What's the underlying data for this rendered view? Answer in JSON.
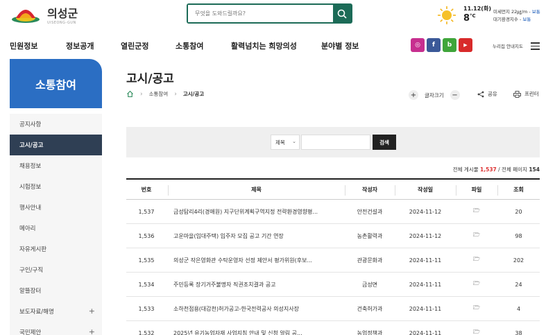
{
  "site": {
    "logo_name": "의성군",
    "logo_sub": "UISEONG-GUN"
  },
  "search": {
    "placeholder": "무엇을 도와드릴까요?"
  },
  "weather": {
    "date": "11.12(화)",
    "temp": "8",
    "temp_unit": "°C",
    "dust_label": "미세먼지 22㎍/m - ",
    "dust_status": "보통",
    "air_label": "대기환경지수 - ",
    "air_status": "보통"
  },
  "nav": {
    "items": [
      "민원정보",
      "정보공개",
      "열린군정",
      "소통참여",
      "활력넘치는 희망의성",
      "분야별 정보"
    ],
    "sns": [
      {
        "name": "instagram",
        "label": "◎",
        "color": "#c72f8f"
      },
      {
        "name": "facebook",
        "label": "f",
        "color": "#3b5998"
      },
      {
        "name": "blog",
        "label": "b",
        "color": "#3fa53a"
      },
      {
        "name": "youtube",
        "label": "▶",
        "color": "#d82a2a"
      }
    ],
    "sitemap": "누리집 안내지도"
  },
  "sidebar": {
    "title": "소통참여",
    "items": [
      {
        "label": "공지사항",
        "active": false,
        "plus": ""
      },
      {
        "label": "고시/공고",
        "active": true,
        "plus": ""
      },
      {
        "label": "채용정보",
        "active": false,
        "plus": ""
      },
      {
        "label": "시험정보",
        "active": false,
        "plus": ""
      },
      {
        "label": "행사안내",
        "active": false,
        "plus": ""
      },
      {
        "label": "메아리",
        "active": false,
        "plus": ""
      },
      {
        "label": "자유게시판",
        "active": false,
        "plus": ""
      },
      {
        "label": "구인/구직",
        "active": false,
        "plus": ""
      },
      {
        "label": "알뜰장터",
        "active": false,
        "plus": ""
      },
      {
        "label": "보도자료/해명",
        "active": false,
        "plus": "+"
      },
      {
        "label": "국민제안",
        "active": false,
        "plus": "+"
      }
    ]
  },
  "page": {
    "title": "고시/공고",
    "breadcrumb": [
      "소통참여",
      "고시/공고"
    ],
    "font_size_label": "글자크기",
    "share_label": "공유",
    "print_label": "프린터"
  },
  "filter": {
    "select_value": "제목",
    "button": "검색"
  },
  "summary": {
    "prefix": "전체 게시물 ",
    "total": "1,537",
    "middle": " / 전체 페이지 ",
    "pages": "154"
  },
  "table": {
    "headers": [
      "번호",
      "제목",
      "작성자",
      "작성일",
      "파일",
      "조회"
    ],
    "rows": [
      {
        "no": "1,537",
        "title": "금성탐리4리(경애원) 지구단위계획구역지정 전략환경영향평...",
        "author": "안전건설과",
        "date": "2024-11-12",
        "views": "20"
      },
      {
        "no": "1,536",
        "title": "고운마을(임대주택) 입주자 모집 공고 기간 연장",
        "author": "농촌활력과",
        "date": "2024-11-12",
        "views": "98"
      },
      {
        "no": "1,535",
        "title": "의성군 작은영화관 수탁운영자 선정 제안서 평가위원(후보...",
        "author": "관광문화과",
        "date": "2024-11-11",
        "views": "202"
      },
      {
        "no": "1,534",
        "title": "주민등록 장기거주불명자 직권조치결과 공고",
        "author": "금성면",
        "date": "2024-11-11",
        "views": "24"
      },
      {
        "no": "1,533",
        "title": "소하천점용(대감천)허가공고-한국전력공사 의성지사장",
        "author": "건축허가과",
        "date": "2024-11-11",
        "views": "4"
      },
      {
        "no": "1,532",
        "title": "2025년 유기농업자재 사업지침 안내 및 신청 알림 공...",
        "author": "농업정책과",
        "date": "2024-11-11",
        "views": "38"
      }
    ]
  }
}
